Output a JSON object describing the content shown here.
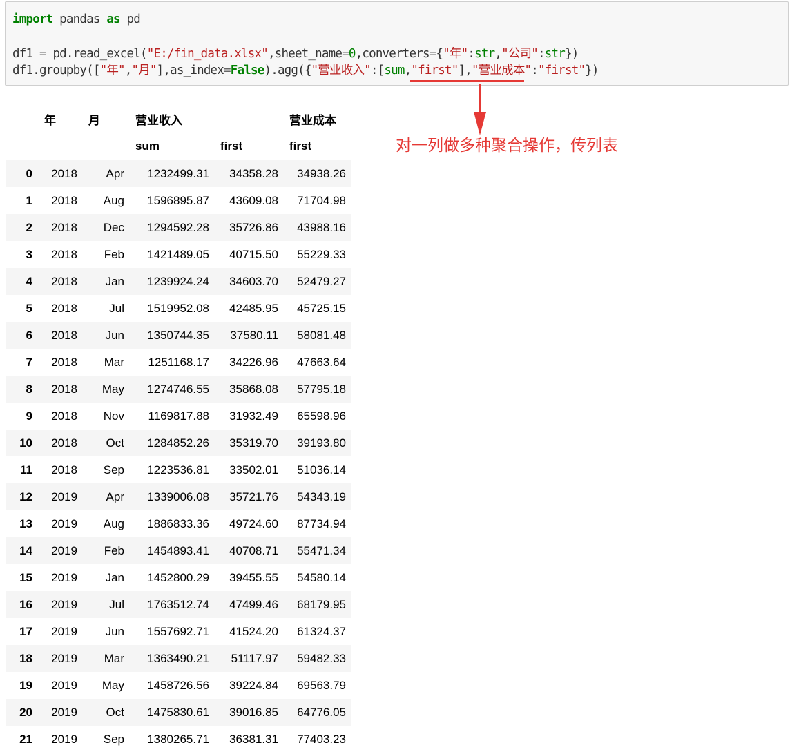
{
  "code": {
    "line1": {
      "t1": "import",
      "t2": " pandas ",
      "t3": "as",
      "t4": " pd"
    },
    "line2": {
      "t1": "df1 ",
      "t2": "=",
      "t3": " pd.read_excel(",
      "t4": "\"E:/fin_data.xlsx\"",
      "t5": ",sheet_name",
      "t6": "=",
      "t7": "0",
      "t8": ",converters",
      "t9": "=",
      "t10": "{",
      "t11": "\"年\"",
      "t12": ":",
      "t13": "str",
      "t14": ",",
      "t15": "\"公司\"",
      "t16": ":",
      "t17": "str",
      "t18": "})"
    },
    "line3": {
      "t1": "df1.groupby([",
      "t2": "\"年\"",
      "t3": ",",
      "t4": "\"月\"",
      "t5": "],as_index",
      "t6": "=",
      "t7": "False",
      "t8": ").agg({",
      "t9": "\"营业收入\"",
      "t10": ":[",
      "t11": "sum",
      "t12": ",",
      "t13": "\"first\"",
      "t14": "],",
      "t15": "\"营业成本\"",
      "t16": ":",
      "t17": "\"first\"",
      "t18": "})"
    }
  },
  "annotation": {
    "text": "对一列做多种聚合操作，传列表",
    "color": "#e53935"
  },
  "table": {
    "header_top": [
      "",
      "年",
      "月",
      "营业收入",
      "",
      "营业成本"
    ],
    "header_sub": [
      "",
      "",
      "",
      "sum",
      "first",
      "first"
    ],
    "rows": [
      [
        "0",
        "2018",
        "Apr",
        "1232499.31",
        "34358.28",
        "34938.26"
      ],
      [
        "1",
        "2018",
        "Aug",
        "1596895.87",
        "43609.08",
        "71704.98"
      ],
      [
        "2",
        "2018",
        "Dec",
        "1294592.28",
        "35726.86",
        "43988.16"
      ],
      [
        "3",
        "2018",
        "Feb",
        "1421489.05",
        "40715.50",
        "55229.33"
      ],
      [
        "4",
        "2018",
        "Jan",
        "1239924.24",
        "34603.70",
        "52479.27"
      ],
      [
        "5",
        "2018",
        "Jul",
        "1519952.08",
        "42485.95",
        "45725.15"
      ],
      [
        "6",
        "2018",
        "Jun",
        "1350744.35",
        "37580.11",
        "58081.48"
      ],
      [
        "7",
        "2018",
        "Mar",
        "1251168.17",
        "34226.96",
        "47663.64"
      ],
      [
        "8",
        "2018",
        "May",
        "1274746.55",
        "35868.08",
        "57795.18"
      ],
      [
        "9",
        "2018",
        "Nov",
        "1169817.88",
        "31932.49",
        "65598.96"
      ],
      [
        "10",
        "2018",
        "Oct",
        "1284852.26",
        "35319.70",
        "39193.80"
      ],
      [
        "11",
        "2018",
        "Sep",
        "1223536.81",
        "33502.01",
        "51036.14"
      ],
      [
        "12",
        "2019",
        "Apr",
        "1339006.08",
        "35721.76",
        "54343.19"
      ],
      [
        "13",
        "2019",
        "Aug",
        "1886833.36",
        "49724.60",
        "87734.94"
      ],
      [
        "14",
        "2019",
        "Feb",
        "1454893.41",
        "40708.71",
        "55471.34"
      ],
      [
        "15",
        "2019",
        "Jan",
        "1452800.29",
        "39455.55",
        "54580.14"
      ],
      [
        "16",
        "2019",
        "Jul",
        "1763512.74",
        "47499.46",
        "68179.95"
      ],
      [
        "17",
        "2019",
        "Jun",
        "1557692.71",
        "41524.20",
        "61324.37"
      ],
      [
        "18",
        "2019",
        "Mar",
        "1363490.21",
        "51117.97",
        "59482.33"
      ],
      [
        "19",
        "2019",
        "May",
        "1458726.56",
        "39224.84",
        "69563.79"
      ],
      [
        "20",
        "2019",
        "Oct",
        "1475830.61",
        "39016.85",
        "64776.05"
      ],
      [
        "21",
        "2019",
        "Sep",
        "1380265.71",
        "36381.31",
        "77403.23"
      ]
    ]
  }
}
